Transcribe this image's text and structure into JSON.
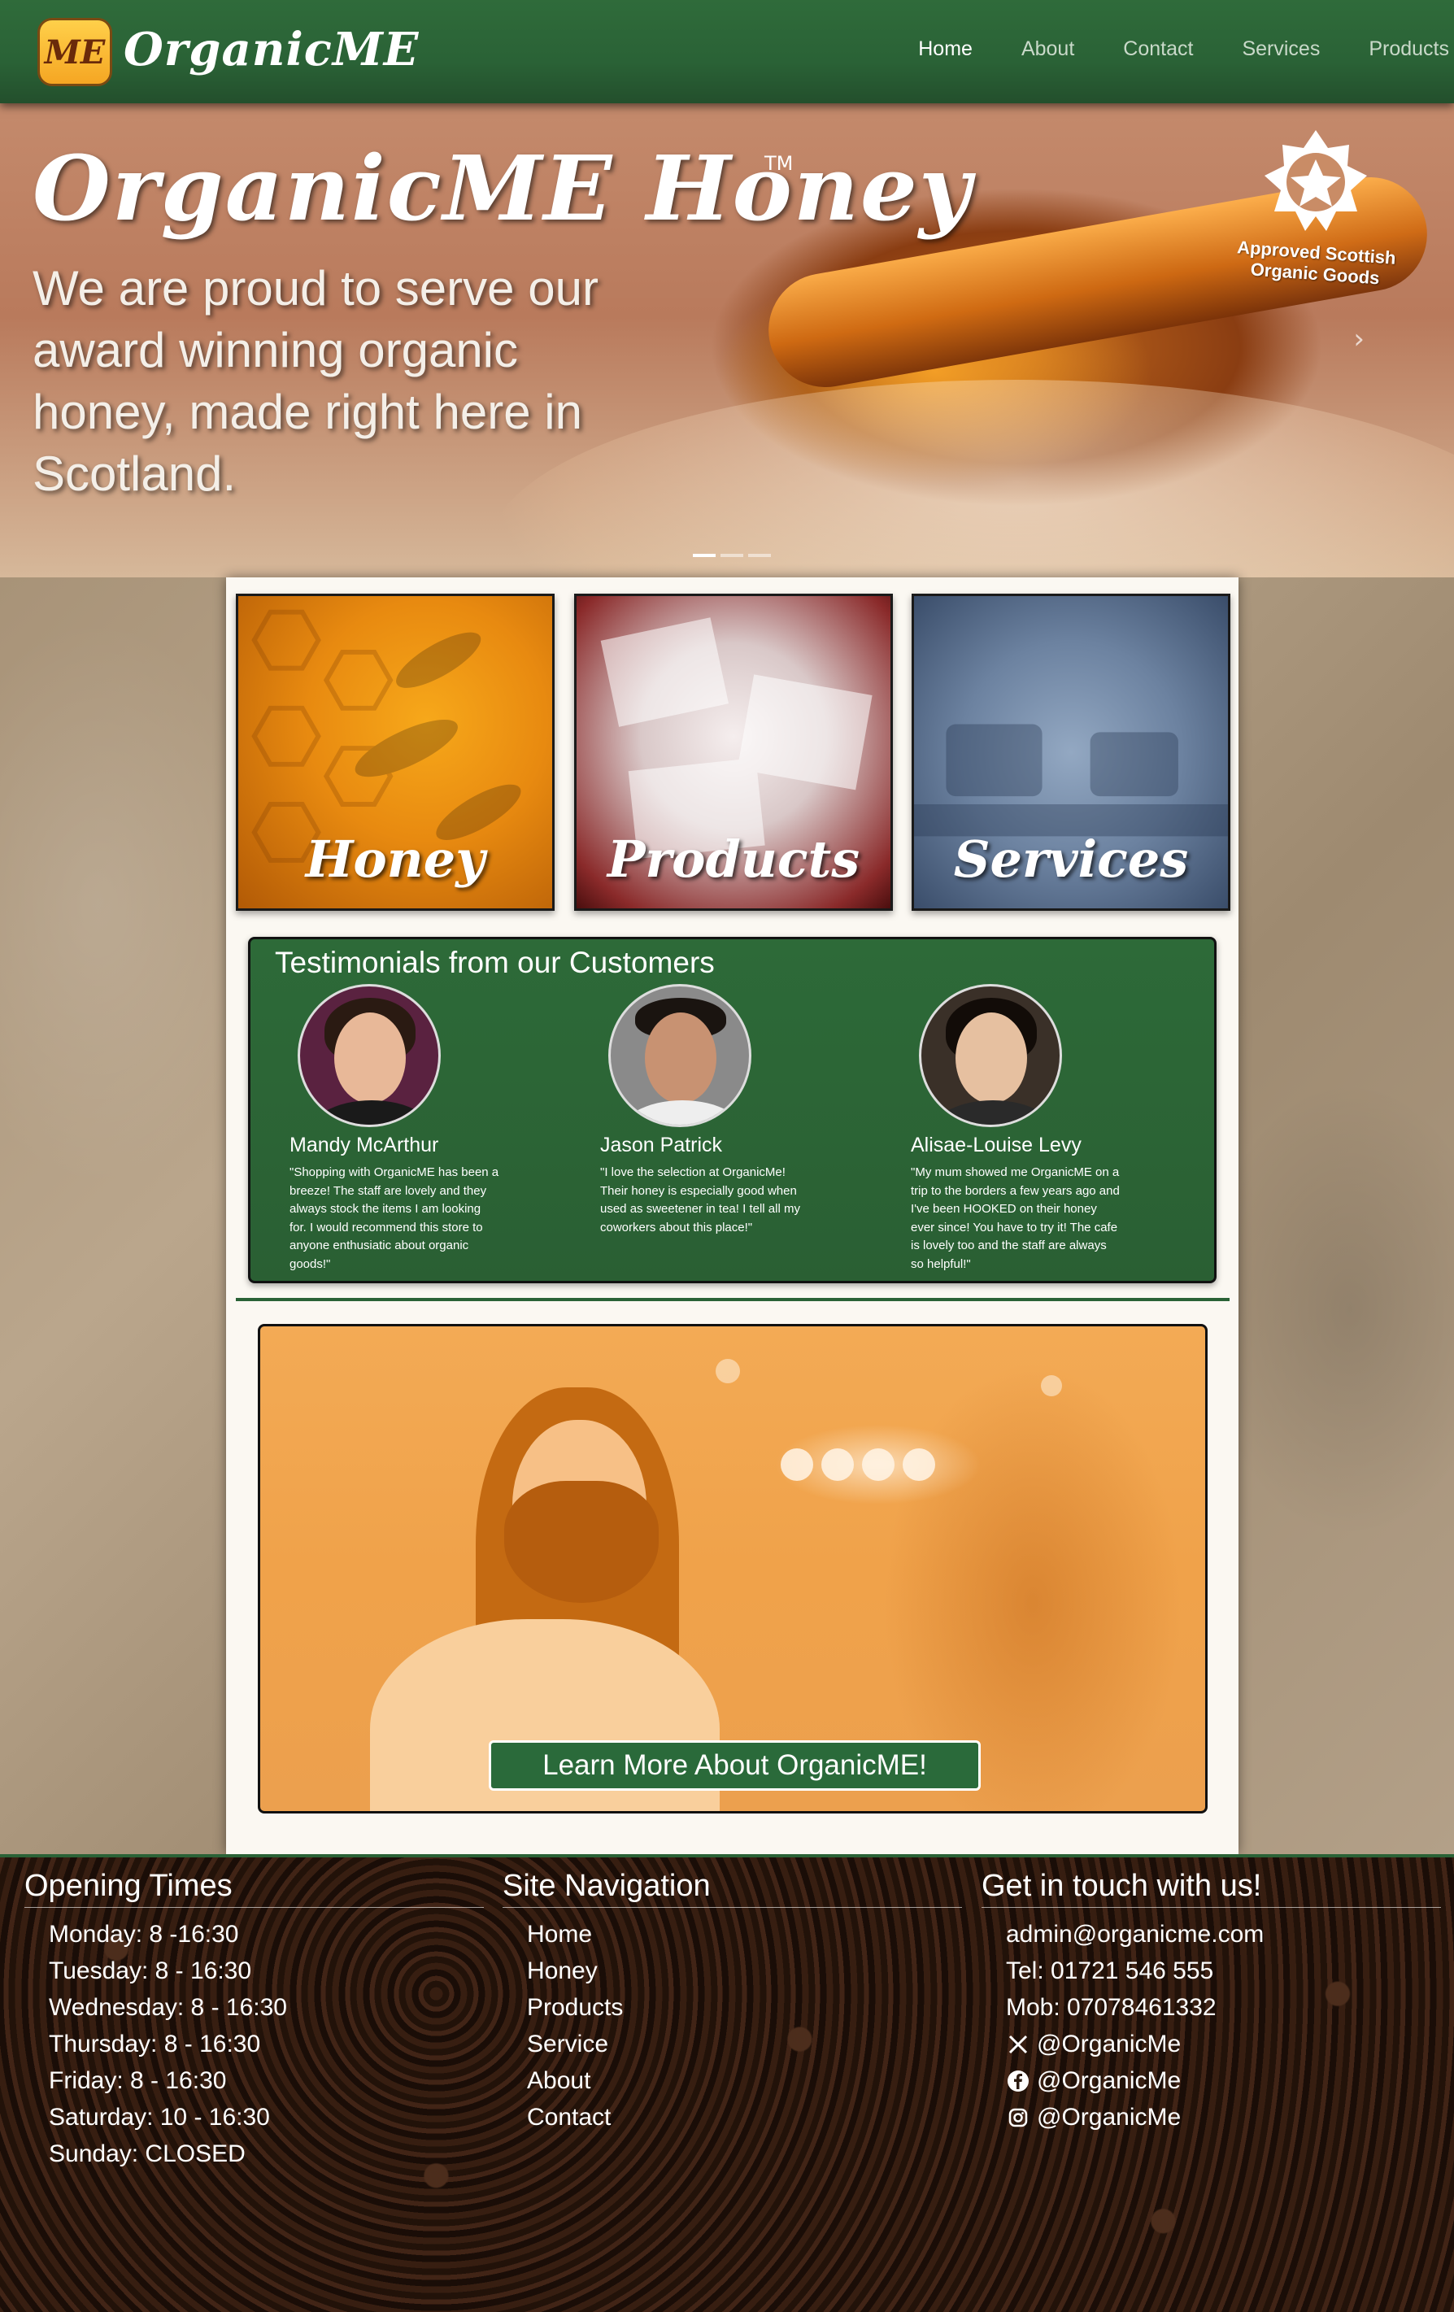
{
  "nav": {
    "brand": "OrganicME",
    "logo_text": "ME",
    "links": [
      "Home",
      "About",
      "Contact",
      "Services",
      "Products"
    ],
    "active": "Home"
  },
  "hero": {
    "title": "OrganicME Honey",
    "trademark": "TM",
    "subtitle": "We are proud to serve our award winning organic honey, made right here in Scotland.",
    "badge": "Approved Scottish Organic Goods",
    "carousel_slides": 3,
    "carousel_active": 1
  },
  "tiles": [
    {
      "label": "Honey"
    },
    {
      "label": "Products"
    },
    {
      "label": "Services"
    }
  ],
  "testimonials": {
    "title": "Testimonials from our Customers",
    "people": [
      {
        "name": "Mandy McArthur",
        "quote": "\"Shopping with OrganicME has been a breeze! The staff are lovely and they always stock the items I am looking for. I would recommend this store to anyone enthusiatic about organic goods!\""
      },
      {
        "name": "Jason Patrick",
        "quote": "\"I love the selection at OrganicMe! Their honey is especially good when used as sweetener in tea! I tell all my coworkers about this place!\""
      },
      {
        "name": "Alisae-Louise Levy",
        "quote": "\"My mum showed me OrganicME on a trip to the borders a few years ago and I've been HOOKED on their honey ever since! You have to try it! The cafe is lovely too and the staff are always so helpful!\""
      }
    ]
  },
  "promo": {
    "button": "Learn More About OrganicME!"
  },
  "footer": {
    "opening": {
      "title": "Opening Times",
      "items": [
        "Monday: 8 -16:30",
        "Tuesday: 8 - 16:30",
        "Wednesday: 8 - 16:30",
        "Thursday: 8 - 16:30",
        "Friday: 8 - 16:30",
        "Saturday: 10 - 16:30",
        "Sunday: CLOSED"
      ]
    },
    "nav": {
      "title": "Site Navigation",
      "items": [
        "Home",
        "Honey",
        "Products",
        "Service",
        "About",
        "Contact"
      ]
    },
    "contact": {
      "title": "Get in touch with us!",
      "email": "admin@organicme.com",
      "tel": "Tel: 01721 546 555",
      "mob": "Mob: 07078461332",
      "x": "@OrganicMe",
      "facebook": "@OrganicMe",
      "instagram": "@OrganicMe"
    }
  },
  "colors": {
    "brand_green": "#2a6236",
    "honey_orange": "#f0a24a"
  }
}
